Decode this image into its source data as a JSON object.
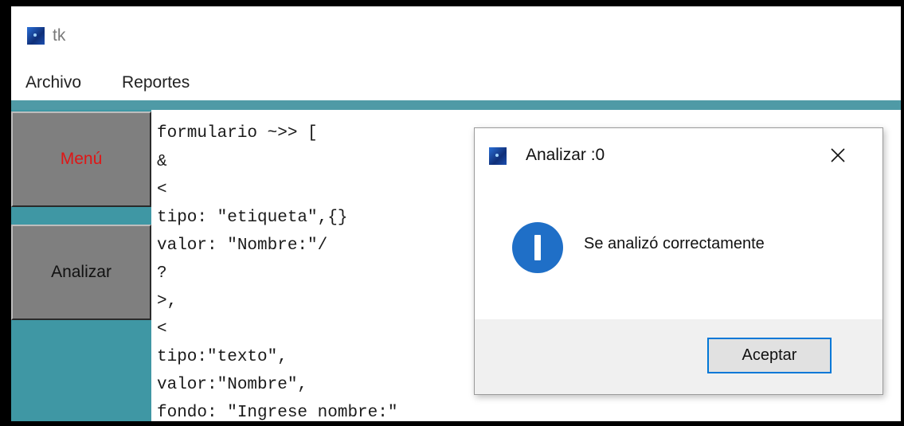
{
  "window": {
    "title": "tk",
    "app_icon": "tk-feather-icon"
  },
  "menubar": {
    "items": [
      "Archivo",
      "Reportes"
    ]
  },
  "sidebar": {
    "menu_label": "Menú",
    "analizar_label": "Analizar",
    "menu_color": "#e01616",
    "background": "#3f97a4"
  },
  "editor": {
    "lines": [
      "formulario ~>> [",
      "&",
      "<",
      "tipo: \"etiqueta\",{}",
      "valor: \"Nombre:\"/",
      "?",
      ">,",
      "<",
      "tipo:\"texto\",",
      "valor:\"Nombre\",",
      "fondo: \"Ingrese nombre:\""
    ]
  },
  "dialog": {
    "title": "Analizar :0",
    "icon": "info-icon",
    "message": "Se analizó correctamente",
    "ok_label": "Aceptar",
    "accent": "#0078d7"
  }
}
